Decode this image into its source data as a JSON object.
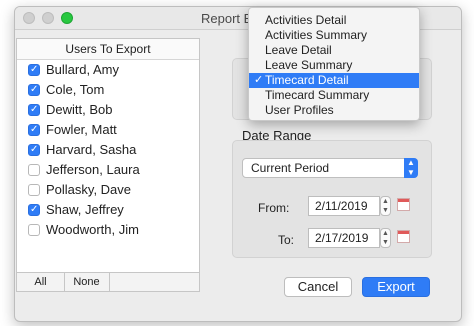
{
  "window": {
    "title": "Report Ex"
  },
  "users": {
    "header": "Users To Export",
    "items": [
      {
        "name": "Bullard, Amy",
        "checked": true
      },
      {
        "name": "Cole, Tom",
        "checked": true
      },
      {
        "name": "Dewitt, Bob",
        "checked": true
      },
      {
        "name": "Fowler, Matt",
        "checked": true
      },
      {
        "name": "Harvard, Sasha",
        "checked": true
      },
      {
        "name": "Jefferson, Laura",
        "checked": false
      },
      {
        "name": "Pollasky, Dave",
        "checked": false
      },
      {
        "name": "Shaw, Jeffrey",
        "checked": true
      },
      {
        "name": "Woodworth, Jim",
        "checked": false
      }
    ],
    "all_label": "All",
    "none_label": "None"
  },
  "report_menu": {
    "items": [
      {
        "label": "Activities Detail",
        "selected": false
      },
      {
        "label": "Activities Summary",
        "selected": false
      },
      {
        "label": "Leave Detail",
        "selected": false
      },
      {
        "label": "Leave Summary",
        "selected": false
      },
      {
        "label": "Timecard Detail",
        "selected": true
      },
      {
        "label": "Timecard Summary",
        "selected": false
      },
      {
        "label": "User Profiles",
        "selected": false
      }
    ],
    "check_glyph": "✓"
  },
  "date_range": {
    "label": "Date Range",
    "period": "Current Period",
    "from_label": "From:",
    "from_value": "2/11/2019",
    "to_label": "To:",
    "to_value": "2/17/2019"
  },
  "buttons": {
    "cancel": "Cancel",
    "export": "Export"
  },
  "colors": {
    "accent": "#2f7cf6",
    "close": "#cfcfcf",
    "zoom": "#28c840"
  },
  "icons": {
    "date_stepper": "up-down-arrows-icon",
    "calendar": "calendar-icon",
    "select_arrow": "up-down-chevron-icon"
  }
}
